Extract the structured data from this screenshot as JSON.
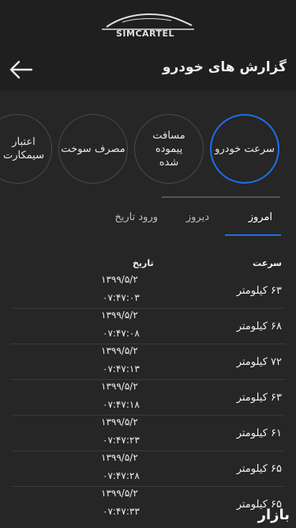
{
  "brand": {
    "logo_text": "SIMCARTEL"
  },
  "header": {
    "title": "گزارش های خودرو"
  },
  "categories": [
    {
      "label": "سرعت خودرو",
      "active": true
    },
    {
      "label": "مسافت پیموده شده",
      "active": false
    },
    {
      "label": "مصرف سوخت",
      "active": false
    },
    {
      "label": "اعتبار سیمکارت",
      "active": false
    }
  ],
  "tabs": [
    {
      "label": "امروز",
      "active": true
    },
    {
      "label": "دیروز",
      "active": false
    },
    {
      "label": "ورود تاریخ",
      "active": false
    }
  ],
  "table": {
    "col_speed": "سرعت",
    "col_date": "تاریخ",
    "rows": [
      {
        "speed": "۶۳ کیلومتر",
        "date": "۱۳۹۹/۵/۲",
        "time": "۰۷:۴۷:۰۳"
      },
      {
        "speed": "۶۸ کیلومتر",
        "date": "۱۳۹۹/۵/۲",
        "time": "۰۷:۴۷:۰۸"
      },
      {
        "speed": "۷۲ کیلومتر",
        "date": "۱۳۹۹/۵/۲",
        "time": "۰۷:۴۷:۱۳"
      },
      {
        "speed": "۶۳ کیلومتر",
        "date": "۱۳۹۹/۵/۲",
        "time": "۰۷:۴۷:۱۸"
      },
      {
        "speed": "۶۱ کیلومتر",
        "date": "۱۳۹۹/۵/۲",
        "time": "۰۷:۴۷:۲۳"
      },
      {
        "speed": "۶۵ کیلومتر",
        "date": "۱۳۹۹/۵/۲",
        "time": "۰۷:۴۷:۲۸"
      },
      {
        "speed": "۶۵ کیلومتر",
        "date": "۱۳۹۹/۵/۲",
        "time": "۰۷:۴۷:۳۳"
      }
    ]
  },
  "watermark": "بازار",
  "colors": {
    "accent": "#1e6fe8",
    "background": "#262626",
    "header_bg": "#1f1f1f"
  },
  "icons": {
    "back": "arrow-left-icon",
    "logo": "car-silhouette-icon"
  }
}
